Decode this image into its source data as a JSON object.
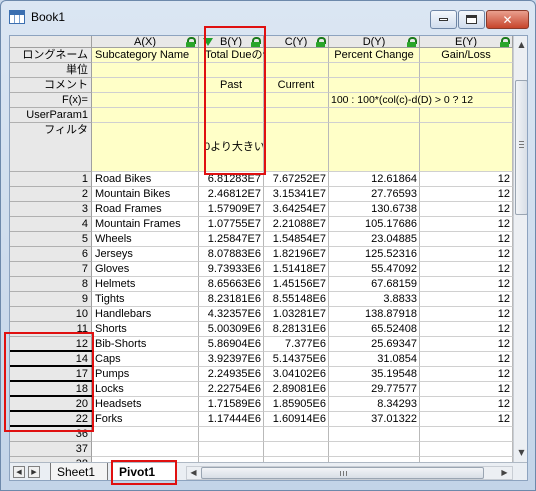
{
  "window": {
    "title": "Book1",
    "buttons": {
      "minimize": "minimize-icon",
      "maximize": "maximize-icon",
      "close": "✕"
    }
  },
  "columns": [
    {
      "label": "A(X)",
      "locked": true
    },
    {
      "label": "B(Y)",
      "locked": true,
      "filtered": true
    },
    {
      "label": "C(Y)",
      "locked": true
    },
    {
      "label": "D(Y)",
      "locked": true
    },
    {
      "label": "E(Y)",
      "locked": true
    }
  ],
  "meta_rows": [
    {
      "label": "ロングネーム",
      "values": [
        "Subcategory Name",
        "Total Dueの合計",
        "",
        "Percent Change",
        "Gain/Loss"
      ]
    },
    {
      "label": "単位",
      "values": [
        "",
        "",
        "",
        "",
        ""
      ]
    },
    {
      "label": "コメント",
      "values": [
        "",
        "Past",
        "Current",
        "",
        ""
      ]
    },
    {
      "label": "F(x)=",
      "values": [
        "",
        "",
        "",
        "100 : 100*(col(c)-d(D) > 0 ? 12",
        ""
      ]
    },
    {
      "label": "UserParam1",
      "values": [
        "",
        "",
        "",
        "",
        ""
      ]
    },
    {
      "label": "フィルタ",
      "values": [
        "",
        "0より大きい",
        "",
        "",
        ""
      ]
    }
  ],
  "data_rows": [
    {
      "idx": "1",
      "a": "Road Bikes",
      "b": "6.81283E7",
      "c": "7.67252E7",
      "d": "12.61864",
      "e": "12"
    },
    {
      "idx": "2",
      "a": "Mountain Bikes",
      "b": "2.46812E7",
      "c": "3.15341E7",
      "d": "27.76593",
      "e": "12"
    },
    {
      "idx": "3",
      "a": "Road Frames",
      "b": "1.57909E7",
      "c": "3.64254E7",
      "d": "130.6738",
      "e": "12"
    },
    {
      "idx": "4",
      "a": "Mountain Frames",
      "b": "1.07755E7",
      "c": "2.21088E7",
      "d": "105.17686",
      "e": "12"
    },
    {
      "idx": "5",
      "a": "Wheels",
      "b": "1.25847E7",
      "c": "1.54854E7",
      "d": "23.04885",
      "e": "12"
    },
    {
      "idx": "6",
      "a": "Jerseys",
      "b": "8.07883E6",
      "c": "1.82196E7",
      "d": "125.52316",
      "e": "12"
    },
    {
      "idx": "7",
      "a": "Gloves",
      "b": "9.73933E6",
      "c": "1.51418E7",
      "d": "55.47092",
      "e": "12"
    },
    {
      "idx": "8",
      "a": "Helmets",
      "b": "8.65663E6",
      "c": "1.45156E7",
      "d": "67.68159",
      "e": "12"
    },
    {
      "idx": "9",
      "a": "Tights",
      "b": "8.23181E6",
      "c": "8.55148E6",
      "d": "3.8833",
      "e": "12"
    },
    {
      "idx": "10",
      "a": "Handlebars",
      "b": "4.32357E6",
      "c": "1.03281E7",
      "d": "138.87918",
      "e": "12"
    },
    {
      "idx": "11",
      "a": "Shorts",
      "b": "5.00309E6",
      "c": "8.28131E6",
      "d": "65.52408",
      "e": "12"
    },
    {
      "idx": "12",
      "a": "Bib-Shorts",
      "b": "5.86904E6",
      "c": "7.377E6",
      "d": "25.69347",
      "e": "12"
    },
    {
      "idx": "14",
      "a": "Caps",
      "b": "3.92397E6",
      "c": "5.14375E6",
      "d": "31.0854",
      "e": "12"
    },
    {
      "idx": "17",
      "a": "Pumps",
      "b": "2.24935E6",
      "c": "3.04102E6",
      "d": "35.19548",
      "e": "12"
    },
    {
      "idx": "18",
      "a": "Locks",
      "b": "2.22754E6",
      "c": "2.89081E6",
      "d": "29.77577",
      "e": "12"
    },
    {
      "idx": "20",
      "a": "Headsets",
      "b": "1.71589E6",
      "c": "1.85905E6",
      "d": "8.34293",
      "e": "12"
    },
    {
      "idx": "22",
      "a": "Forks",
      "b": "1.17444E6",
      "c": "1.60914E6",
      "d": "37.01322",
      "e": "12"
    },
    {
      "idx": "36",
      "a": "",
      "b": "",
      "c": "",
      "d": "",
      "e": ""
    },
    {
      "idx": "37",
      "a": "",
      "b": "",
      "c": "",
      "d": "",
      "e": ""
    },
    {
      "idx": "38",
      "a": "",
      "b": "",
      "c": "",
      "d": "",
      "e": ""
    }
  ],
  "tabs": [
    {
      "label": "Sheet1",
      "active": false
    },
    {
      "label": "Pivot1",
      "active": true
    }
  ],
  "colors": {
    "header_fill": "#e8e8e8",
    "meta_fill": "#ffffc8",
    "highlight": "#e01010",
    "lock": "#2aa52a"
  }
}
